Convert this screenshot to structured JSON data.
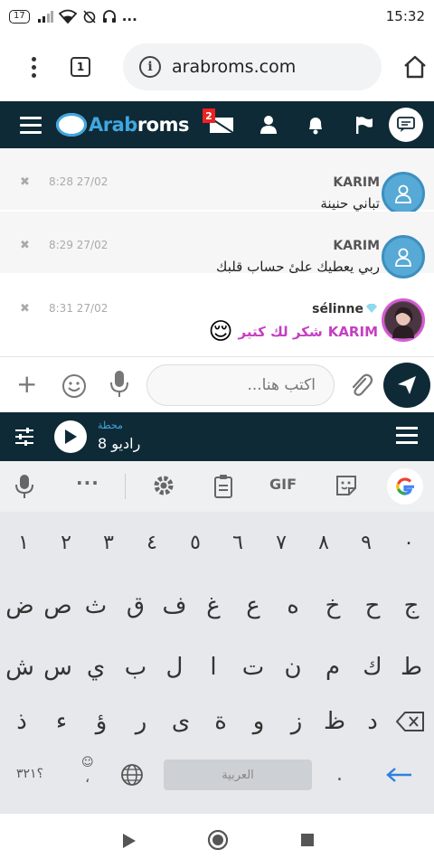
{
  "status": {
    "battery": "17",
    "time": "15:32",
    "more": "..."
  },
  "browser": {
    "tab_count": "1",
    "url": "arabroms.com"
  },
  "header": {
    "logo_a": "Arab",
    "logo_b": "roms",
    "inbox_badge": "2"
  },
  "messages": [
    {
      "time": "8:28 27/02",
      "name": "KARIM",
      "text": "تباني حنينة",
      "close": "✖"
    },
    {
      "time": "8:29 27/02",
      "name": "KARIM",
      "text": "ربي يعطيك علىٔ حساب قلبك",
      "close": "✖"
    },
    {
      "time": "8:31 27/02",
      "name": "sélinne",
      "mention": "KARIM",
      "text": "شكر لك كتير",
      "emoji": "😌",
      "close": "✖"
    }
  ],
  "composer": {
    "placeholder": "اكتب هنا...",
    "plus": "+"
  },
  "radio": {
    "label": "محطة",
    "station": "راديو 8"
  },
  "keyboard": {
    "gif": "GIF",
    "row1": [
      "١",
      "٢",
      "٣",
      "٤",
      "٥",
      "٦",
      "٧",
      "٨",
      "٩",
      "٠"
    ],
    "row2": [
      "ض",
      "ص",
      "ث",
      "ق",
      "ف",
      "غ",
      "ع",
      "ه",
      "خ",
      "ح",
      "ج"
    ],
    "row3": [
      "ش",
      "س",
      "ي",
      "ب",
      "ل",
      "ا",
      "ت",
      "ن",
      "م",
      "ك",
      "ط"
    ],
    "row4": [
      "ذ",
      "ء",
      "ؤ",
      "ر",
      "ى",
      "ة",
      "و",
      "ز",
      "ظ",
      "د"
    ],
    "symbols_key": "؟٣٢١",
    "space_label": "العربية",
    "period": ".",
    "comma": "،"
  }
}
